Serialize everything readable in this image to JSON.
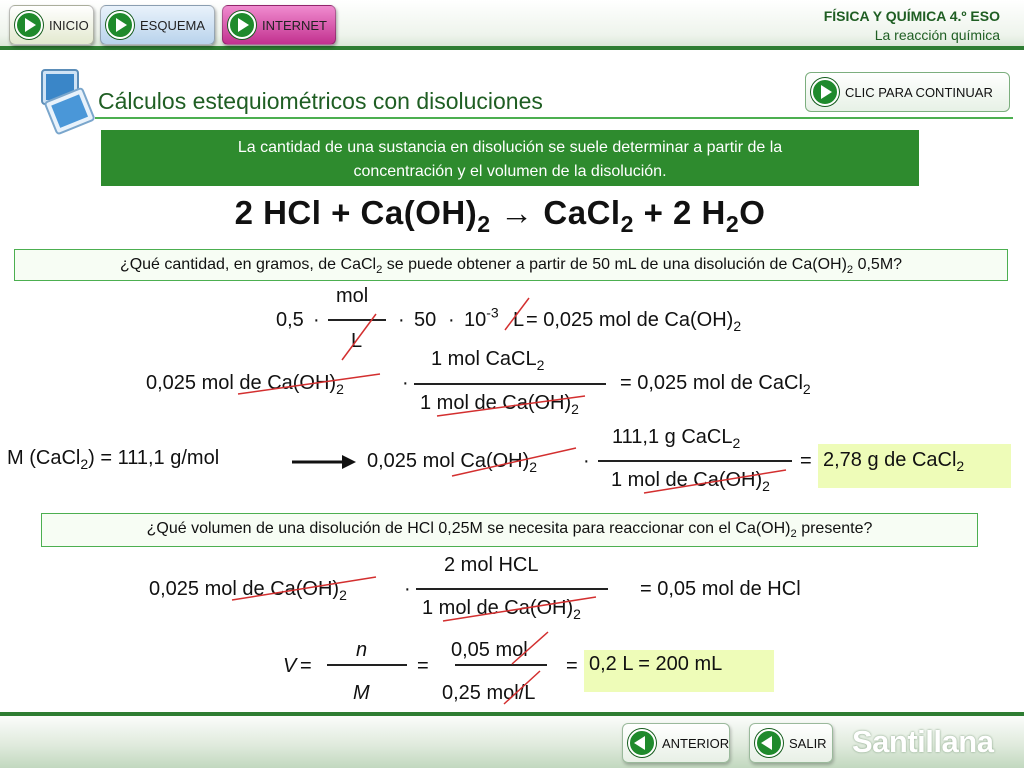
{
  "nav": {
    "inicio": "INICIO",
    "esquema": "ESQUEMA",
    "internet": "INTERNET"
  },
  "course": {
    "subject": "FÍSICA Y QUÍMICA 4.º ESO",
    "unit": "La reacción química"
  },
  "title": "Cálculos estequiométricos con disoluciones",
  "continue_label": "CLIC PARA CONTINUAR",
  "info": {
    "line1": "La cantidad de una sustancia en disolución se suele determinar a partir de la",
    "line2": "concentración y el volumen de la disolución."
  },
  "equation": {
    "p1": "2 HCl  + Ca(OH)",
    "p1_sub": "2",
    "arrow": " → ",
    "p2": "CaCl",
    "p2_sub": "2",
    "p3": " + 2 H",
    "p3_sub": "2",
    "p4": "O"
  },
  "question1": {
    "a": "¿Qué cantidad, en gramos, de CaCl",
    "a_sub": "2",
    "b": " se puede obtener a partir de 50 mL de una disolución de Ca(OH)",
    "b_sub": "2",
    "c": " 0,5M?"
  },
  "calc1": {
    "lead": "0,5",
    "num": "mol",
    "den": "L",
    "mid": "50",
    "pow_base": "10",
    "pow_exp": "-3",
    "unit": "L",
    "result": " = 0,025 mol de Ca(OH)",
    "result_sub": "2"
  },
  "calc2": {
    "lead": "0,025 mol de Ca(OH)",
    "lead_sub": "2",
    "num": "1 mol CaCL",
    "num_sub": "2",
    "den": "1 mol de Ca(OH)",
    "den_sub": "2",
    "result": "= 0,025 mol de CaCl",
    "result_sub": "2"
  },
  "calc3": {
    "molar": "M (CaCl",
    "molar_sub": "2",
    "molar_end": ") = 111,1 g/mol",
    "lead": "0,025 mol Ca(OH)",
    "lead_sub": "2",
    "num": "111,1 g CaCL",
    "num_sub": "2",
    "den": "1 mol de Ca(OH)",
    "den_sub": "2",
    "eq": "=",
    "answer": "2,78 g de CaCl",
    "answer_sub": "2"
  },
  "question2": {
    "a": "¿Qué volumen de una disolución de HCl 0,25M se necesita para reaccionar con el Ca(OH)",
    "a_sub": "2",
    "b": " presente?"
  },
  "calc4": {
    "lead": "0,025 mol de Ca(OH)",
    "lead_sub": "2",
    "num": "2 mol HCL",
    "den": "1 mol de Ca(OH)",
    "den_sub": "2",
    "result": "= 0,05 mol de HCl"
  },
  "calc5": {
    "v": "V",
    "eq1": "=",
    "n": "n",
    "m": "M",
    "eq2": "=",
    "num": "0,05 mol",
    "den": "0,25 mol/L",
    "eq3": "=",
    "answer": "0,2 L = 200 mL"
  },
  "footer": {
    "anterior": "ANTERIOR",
    "salir": "SALIR",
    "brand": "Santillana"
  },
  "colors": {
    "accent_green": "#2e8b2e",
    "strike_red": "#d32f2f",
    "highlight": "#eefcb8"
  }
}
